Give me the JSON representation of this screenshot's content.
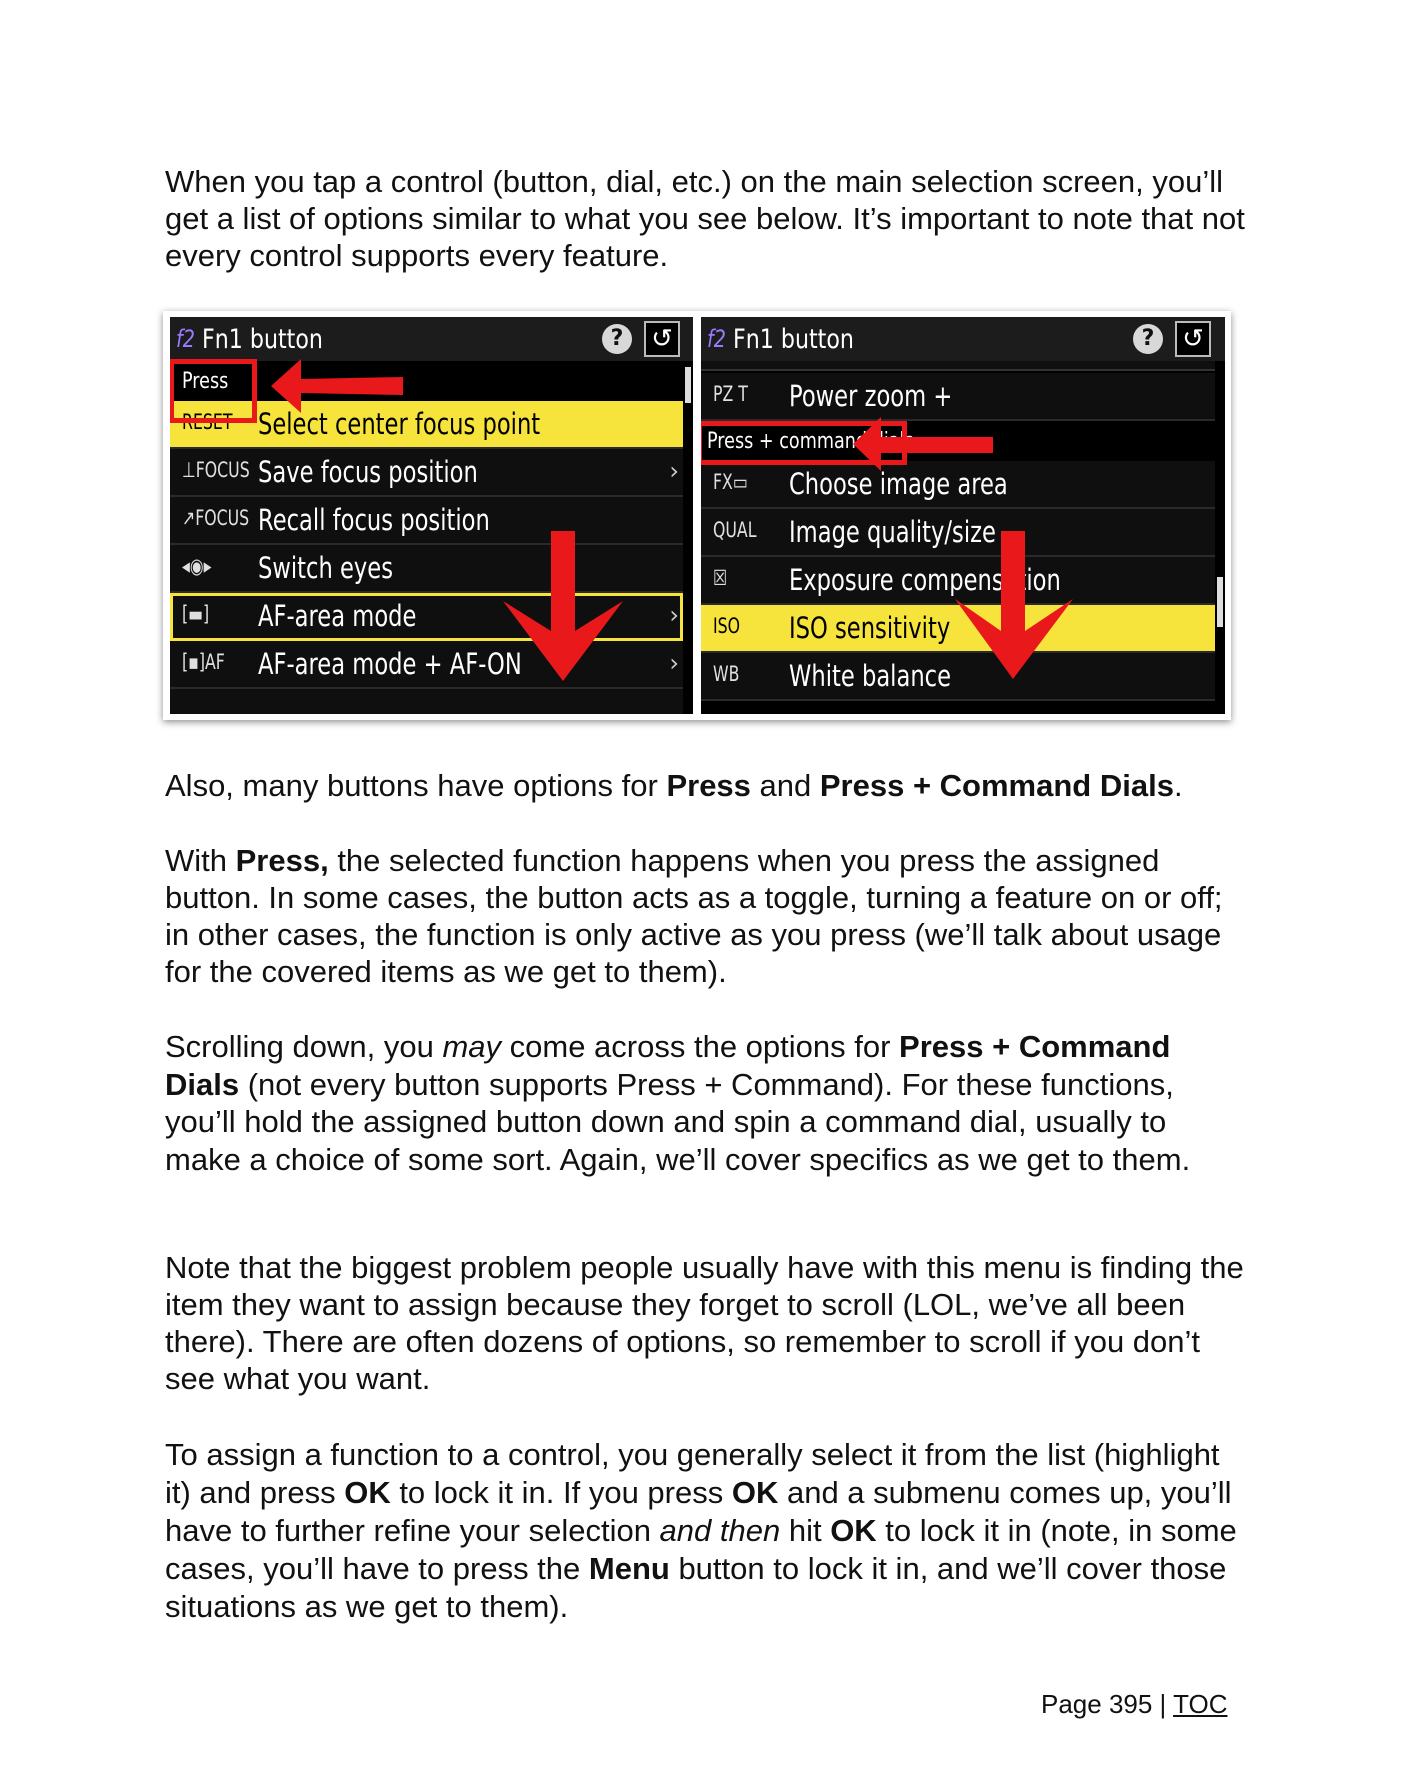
{
  "intro": "When you tap a control (button, dial, etc.) on the main selection screen, you’ll get a list of options similar to what you see below. It’s important to note that not every control supports every feature.",
  "screenshot": {
    "left": {
      "title_prefix": "f2",
      "title": "Fn1 button",
      "help_glyph": "?",
      "back_glyph": "↺",
      "section_label": "Press",
      "items": [
        {
          "icon": "RESET",
          "label": "Select center focus point",
          "selected": true,
          "chevron": ""
        },
        {
          "icon": "⊥FOCUS",
          "label": "Save focus position",
          "selected": false,
          "chevron": "›"
        },
        {
          "icon": "↗FOCUS",
          "label": "Recall focus position",
          "selected": false,
          "chevron": ""
        },
        {
          "icon": "◂◉▸",
          "label": "Switch eyes",
          "selected": false,
          "chevron": ""
        },
        {
          "icon": "[▬]",
          "label": "AF-area mode",
          "selected": false,
          "chevron": "›"
        },
        {
          "icon": "[▪]AF",
          "label": "AF-area mode + AF-ON",
          "selected": false,
          "chevron": "›"
        }
      ]
    },
    "right": {
      "title_prefix": "f2",
      "title": "Fn1 button",
      "help_glyph": "?",
      "back_glyph": "↺",
      "items_top": [
        {
          "icon": "PZ T",
          "label": "Power zoom +"
        }
      ],
      "section_label": "Press + command dials",
      "items": [
        {
          "icon": "FX▭",
          "label": "Choose image area",
          "selected": false
        },
        {
          "icon": "QUAL",
          "label": "Image quality/size",
          "selected": false
        },
        {
          "icon": "☒",
          "label": "Exposure compensation",
          "selected": false
        },
        {
          "icon": "ISO",
          "label": "ISO sensitivity",
          "selected": true
        },
        {
          "icon": "WB",
          "label": "White balance",
          "selected": false
        }
      ]
    }
  },
  "p2": {
    "a": "Also, many buttons have options for ",
    "b1": "Press",
    "c": " and ",
    "b2": "Press + Command Dials",
    "d": "."
  },
  "p3": {
    "a": "With ",
    "b1": "Press,",
    "c": " the selected function happens when you press the assigned button. In some cases, the button acts as a toggle, turning a feature on or off; in other cases, the function is only active as you press (we’ll talk about usage for the covered items as we get to them)."
  },
  "p4": {
    "a": "Scrolling down, you ",
    "i1": "may",
    "b": " come across the options for ",
    "b1": "Press + Command Dials",
    "c": " (not every button supports Press + Command). For these functions, you’ll hold the assigned button down and spin a command dial, usually to make a choice of some sort. Again, we’ll cover specifics as we get to them."
  },
  "p5": "Note that the biggest problem people usually have with this menu is finding the item they want to assign because they forget to scroll (LOL, we’ve all been there). There are often dozens of options, so remember to scroll if you don’t see what you want.",
  "p6": {
    "a": "To assign a function to a control, you generally select it from the list (highlight it) and press ",
    "b1": "OK",
    "b": " to lock it in. If you press ",
    "b2": "OK",
    "c": " and a submenu comes up, you’ll have to further refine your selection ",
    "i1": "and then",
    "d": " hit ",
    "b3": "OK",
    "e": " to lock it in (note, in some cases, you’ll have to press the ",
    "b4": "Menu",
    "f": " button to lock it in, and we’ll cover those situations as we get to them)."
  },
  "footer": {
    "page": "Page 395 | ",
    "toc": "TOC"
  },
  "colors": {
    "highlight_yellow": "#f6e33c",
    "callout_red": "#e8181b",
    "screen_bg": "#000000",
    "title_purple": "#9a7bff"
  }
}
